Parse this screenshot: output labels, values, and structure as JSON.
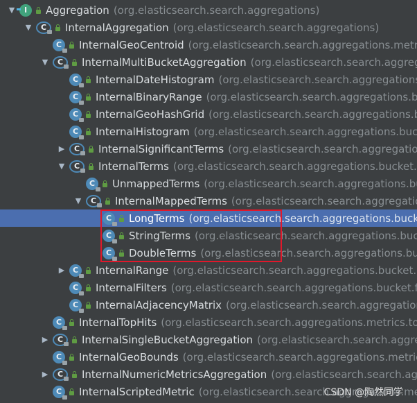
{
  "tree": [
    {
      "name": "Aggregation",
      "pkg": "(org.elasticsearch.search.aggregations)",
      "indent": 0,
      "arrow": "▼",
      "icon": "interface",
      "selected": false
    },
    {
      "name": "InternalAggregation",
      "pkg": "(org.elasticsearch.search.aggregations)",
      "indent": 1,
      "arrow": "▼",
      "icon": "abstract",
      "selected": false
    },
    {
      "name": "InternalGeoCentroid",
      "pkg": "(org.elasticsearch.search.aggregations.metrics.geocentroid)",
      "indent": 2,
      "arrow": "",
      "icon": "class",
      "selected": false
    },
    {
      "name": "InternalMultiBucketAggregation",
      "pkg": "(org.elasticsearch.search.aggregations)",
      "indent": 2,
      "arrow": "▼",
      "icon": "abstract",
      "selected": false
    },
    {
      "name": "InternalDateHistogram",
      "pkg": "(org.elasticsearch.search.aggregations.bucket.histogram)",
      "indent": 3,
      "arrow": "",
      "icon": "class",
      "selected": false
    },
    {
      "name": "InternalBinaryRange",
      "pkg": "(org.elasticsearch.search.aggregations.bucket.range)",
      "indent": 3,
      "arrow": "",
      "icon": "class",
      "selected": false
    },
    {
      "name": "InternalGeoHashGrid",
      "pkg": "(org.elasticsearch.search.aggregations.bucket.geogrid)",
      "indent": 3,
      "arrow": "",
      "icon": "class",
      "selected": false
    },
    {
      "name": "InternalHistogram",
      "pkg": "(org.elasticsearch.search.aggregations.bucket.histogram)",
      "indent": 3,
      "arrow": "",
      "icon": "class",
      "selected": false
    },
    {
      "name": "InternalSignificantTerms",
      "pkg": "(org.elasticsearch.search.aggregations.bucket.significant)",
      "indent": 3,
      "arrow": "▶",
      "icon": "abstract",
      "selected": false
    },
    {
      "name": "InternalTerms",
      "pkg": "(org.elasticsearch.search.aggregations.bucket.terms)",
      "indent": 3,
      "arrow": "▼",
      "icon": "abstract",
      "selected": false
    },
    {
      "name": "UnmappedTerms",
      "pkg": "(org.elasticsearch.search.aggregations.bucket.terms)",
      "indent": 4,
      "arrow": "",
      "icon": "class",
      "selected": false
    },
    {
      "name": "InternalMappedTerms",
      "pkg": "(org.elasticsearch.search.aggregations.bucket.terms)",
      "indent": 4,
      "arrow": "▼",
      "icon": "abstract",
      "selected": false
    },
    {
      "name": "LongTerms",
      "pkg": "(org.elasticsearch.search.aggregations.bucket.terms)",
      "indent": 5,
      "arrow": "",
      "icon": "class",
      "selected": true
    },
    {
      "name": "StringTerms",
      "pkg": "(org.elasticsearch.search.aggregations.bucket.terms)",
      "indent": 5,
      "arrow": "",
      "icon": "class",
      "selected": false
    },
    {
      "name": "DoubleTerms",
      "pkg": "(org.elasticsearch.search.aggregations.bucket.terms)",
      "indent": 5,
      "arrow": "",
      "icon": "class",
      "selected": false
    },
    {
      "name": "InternalRange",
      "pkg": "(org.elasticsearch.search.aggregations.bucket.range)",
      "indent": 3,
      "arrow": "▶",
      "icon": "class",
      "selected": false
    },
    {
      "name": "InternalFilters",
      "pkg": "(org.elasticsearch.search.aggregations.bucket.filters)",
      "indent": 3,
      "arrow": "",
      "icon": "class",
      "selected": false
    },
    {
      "name": "InternalAdjacencyMatrix",
      "pkg": "(org.elasticsearch.search.aggregations.bucket.adjacency)",
      "indent": 3,
      "arrow": "",
      "icon": "class",
      "selected": false
    },
    {
      "name": "InternalTopHits",
      "pkg": "(org.elasticsearch.search.aggregations.metrics.tophits)",
      "indent": 2,
      "arrow": "",
      "icon": "class",
      "selected": false
    },
    {
      "name": "InternalSingleBucketAggregation",
      "pkg": "(org.elasticsearch.search.aggregations.bucket)",
      "indent": 2,
      "arrow": "▶",
      "icon": "abstract",
      "selected": false
    },
    {
      "name": "InternalGeoBounds",
      "pkg": "(org.elasticsearch.search.aggregations.metrics.geobounds)",
      "indent": 2,
      "arrow": "",
      "icon": "class",
      "selected": false
    },
    {
      "name": "InternalNumericMetricsAggregation",
      "pkg": "(org.elasticsearch.search.aggregations.metrics)",
      "indent": 2,
      "arrow": "▶",
      "icon": "abstract",
      "selected": false
    },
    {
      "name": "InternalScriptedMetric",
      "pkg": "(org.elasticsearch.search.aggregations.metrics.scripted)",
      "indent": 2,
      "arrow": "",
      "icon": "class",
      "selected": false
    }
  ],
  "watermark": "CSDN @陶然同学",
  "colors": {
    "selection": "#4b6eaf",
    "highlight_border": "#e0182b",
    "class_icon": "#4e8ab7"
  }
}
